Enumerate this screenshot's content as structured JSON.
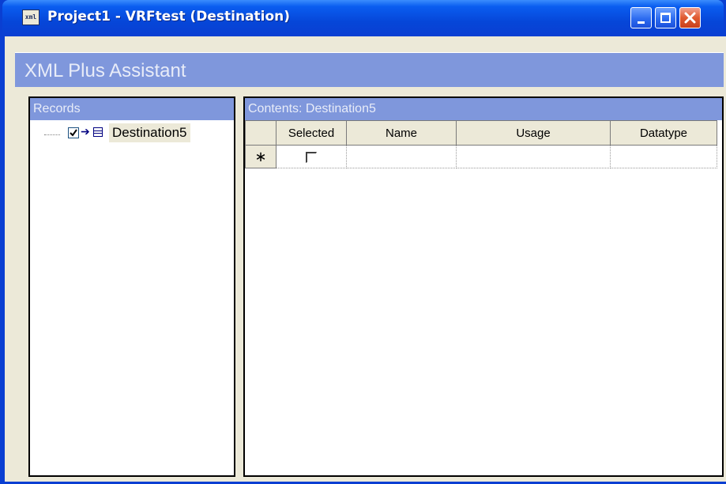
{
  "window": {
    "title": "Project1 - VRFtest (Destination)",
    "app_icon_text": "xml",
    "icon": "xml-document-icon"
  },
  "banner": {
    "title": "XML Plus Assistant"
  },
  "records": {
    "header": "Records",
    "items": [
      {
        "label": "Destination5",
        "checked": true
      }
    ]
  },
  "contents": {
    "header": "Contents: Destination5",
    "columns": [
      "Selected",
      "Name",
      "Usage",
      "Datatype"
    ],
    "new_row_marker": "∗",
    "rows": []
  },
  "colors": {
    "titlebar": "#0a3fd2",
    "banner": "#7f97dc",
    "client": "#ece9d8"
  }
}
